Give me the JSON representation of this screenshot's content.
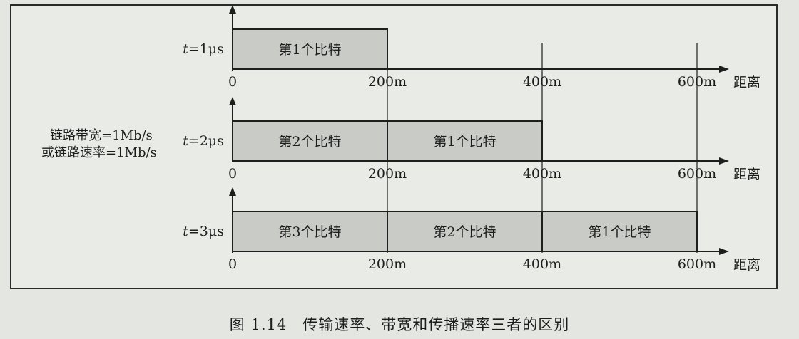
{
  "rows": [
    {
      "time_label": "t=1μs",
      "bits": [
        "第1个比特"
      ],
      "ticks": [
        "0",
        "200m",
        "400m",
        "600m"
      ],
      "axis_label": "距离"
    },
    {
      "time_label": "t=2μs",
      "bits": [
        "第2个比特",
        "第1个比特"
      ],
      "ticks": [
        "0",
        "200m",
        "400m",
        "600m"
      ],
      "axis_label": "距离"
    },
    {
      "time_label": "t=3μs",
      "bits": [
        "第3个比特",
        "第2个比特",
        "第1个比特"
      ],
      "ticks": [
        "0",
        "200m",
        "400m",
        "600m"
      ],
      "axis_label": "距离"
    }
  ],
  "side_labels": {
    "bandwidth": "链路带宽=1Mb/s",
    "rate": "或链路速率=1Mb/s"
  },
  "caption": {
    "number": "图 1.14",
    "text": "传输速率、带宽和传播速率三者的区别"
  },
  "colors": {
    "bit_fill": "#c9cbc6",
    "line": "#1e1e1e",
    "background": "#e4e6e1"
  }
}
